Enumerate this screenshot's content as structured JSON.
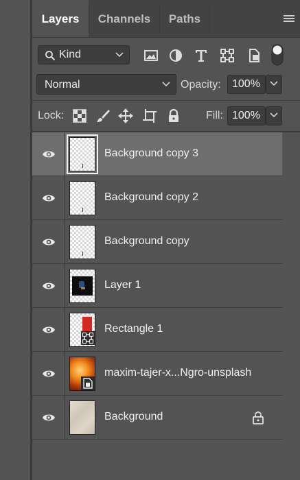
{
  "tabs": [
    {
      "label": "Layers",
      "active": true
    },
    {
      "label": "Channels",
      "active": false
    },
    {
      "label": "Paths",
      "active": false
    }
  ],
  "filter": {
    "kind_label": "Kind",
    "icons": [
      "image-filter-icon",
      "adjustment-filter-icon",
      "type-filter-icon",
      "shape-filter-icon",
      "smart-object-filter-icon",
      "filter-toggle-icon"
    ]
  },
  "blend": {
    "mode": "Normal",
    "opacity_label": "Opacity:",
    "opacity_value": "100%",
    "fill_label": "Fill:",
    "fill_value": "100%"
  },
  "lock": {
    "label": "Lock:",
    "icons": [
      "lock-transparent-pixels-icon",
      "lock-image-pixels-icon",
      "lock-position-icon",
      "lock-artboard-icon",
      "lock-all-icon"
    ]
  },
  "layers": [
    {
      "name": "Background copy 3",
      "selected": true,
      "thumb": "transparent"
    },
    {
      "name": "Background copy 2",
      "selected": false,
      "thumb": "transparent"
    },
    {
      "name": "Background copy",
      "selected": false,
      "thumb": "transparent"
    },
    {
      "name": "Layer 1",
      "selected": false,
      "thumb": "dark"
    },
    {
      "name": "Rectangle 1",
      "selected": false,
      "thumb": "shape"
    },
    {
      "name": "maxim-tajer-x...Ngro-unsplash",
      "selected": false,
      "thumb": "smart"
    },
    {
      "name": "Background",
      "selected": false,
      "thumb": "paper",
      "locked": true
    }
  ],
  "colors": {
    "panel_bg": "#535353",
    "tab_bar_bg": "#434343",
    "selected_row": "#6e6e6e",
    "shape_red": "#d12a22"
  }
}
